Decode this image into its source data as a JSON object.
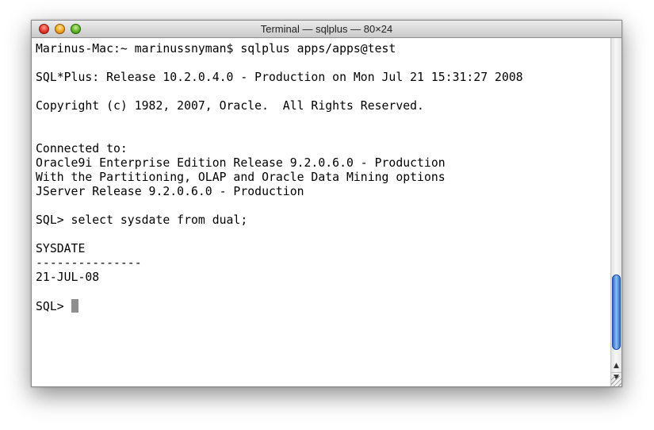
{
  "window": {
    "title": "Terminal — sqlplus — 80×24"
  },
  "terminal": {
    "lines": [
      "Marinus-Mac:~ marinussnyman$ sqlplus apps/apps@test",
      "",
      "SQL*Plus: Release 10.2.0.4.0 - Production on Mon Jul 21 15:31:27 2008",
      "",
      "Copyright (c) 1982, 2007, Oracle.  All Rights Reserved.",
      "",
      "",
      "Connected to:",
      "Oracle9i Enterprise Edition Release 9.2.0.6.0 - Production",
      "With the Partitioning, OLAP and Oracle Data Mining options",
      "JServer Release 9.2.0.6.0 - Production",
      "",
      "SQL> select sysdate from dual;",
      "",
      "SYSDATE",
      "---------------",
      "21-JUL-08",
      ""
    ],
    "prompt": "SQL> "
  },
  "scrollbar": {
    "up_arrow": "▲",
    "down_arrow": "▼"
  },
  "colors": {
    "cursor": "#8f8f8f",
    "scroll_thumb": "#4a8de0"
  },
  "icons": [
    "close-icon",
    "minimize-icon",
    "zoom-icon",
    "scroll-up-arrow-icon",
    "scroll-down-arrow-icon",
    "resize-grip-icon"
  ]
}
